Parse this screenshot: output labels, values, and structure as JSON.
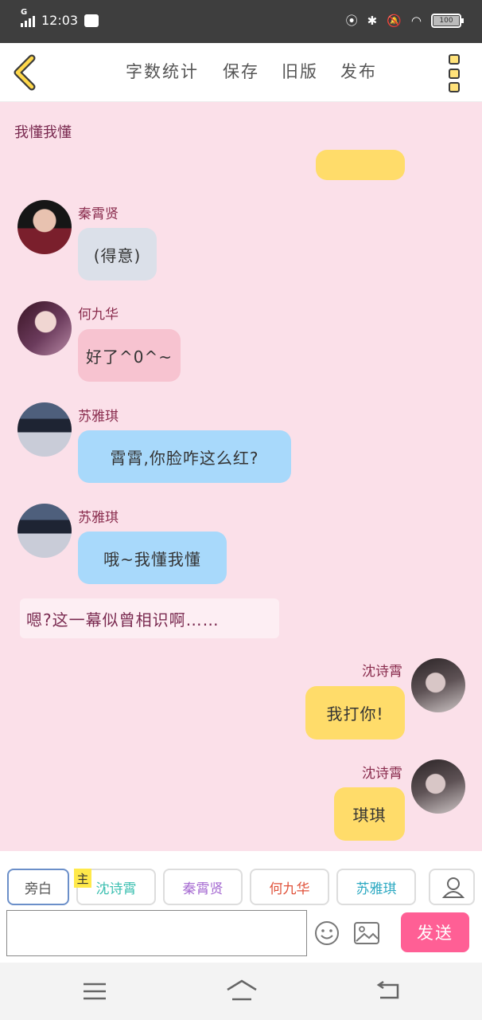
{
  "status_bar": {
    "network": "G",
    "time": "12:03",
    "battery": "100"
  },
  "nav": {
    "tabs": [
      "字数统计",
      "保存",
      "旧版",
      "发布"
    ]
  },
  "chat": {
    "title": "我懂我懂",
    "messages": [
      {
        "sender": "秦霄贤",
        "text": "(得意)"
      },
      {
        "sender": "何九华",
        "text": "好了^0^~"
      },
      {
        "sender": "苏雅琪",
        "text": "霄霄,你脸咋这么红?"
      },
      {
        "sender": "苏雅琪",
        "text": "哦~我懂我懂"
      },
      {
        "narration": "嗯?这一幕似曾相识啊……"
      },
      {
        "sender": "沈诗霄",
        "text": "我打你!"
      },
      {
        "sender": "沈诗霄",
        "text": "琪琪"
      }
    ]
  },
  "characters": {
    "main_tag": "主",
    "chips": [
      {
        "label": "旁白",
        "color": "#555555"
      },
      {
        "label": "沈诗霄",
        "color": "#3bbfb0"
      },
      {
        "label": "秦霄贤",
        "color": "#a56ad1"
      },
      {
        "label": "何九华",
        "color": "#e0523a"
      },
      {
        "label": "苏雅琪",
        "color": "#2ca9c2"
      }
    ]
  },
  "composer": {
    "placeholder": "",
    "send_label": "发送"
  },
  "colors": {
    "background": "#fbe0e9",
    "send": "#ff5f95",
    "name": "#8a2d4e"
  }
}
